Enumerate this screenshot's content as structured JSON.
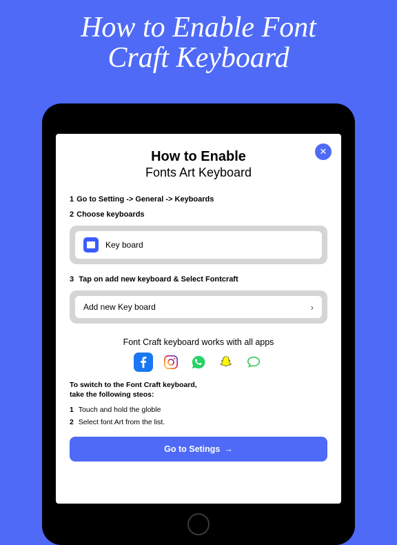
{
  "hero": {
    "line1": "How to Enable Font",
    "line2": "Craft Keyboard"
  },
  "modal": {
    "title1": "How to Enable",
    "title2": "Fonts Art Keyboard",
    "close_glyph": "✕",
    "steps": {
      "s1": "Go to Setting -> General -> Keyboards",
      "s2": "Choose keyboards",
      "s3": "Tap on add new keyboard & Select Fontcraft"
    },
    "row1_label": "Key board",
    "row2_label": "Add new Key board",
    "chevron": "›",
    "works_with": "Font Craft keyboard works with all apps",
    "switch_hdr_l1": "To switch to the Font Craft keyboard,",
    "switch_hdr_l2": "take the following steos:",
    "switch_s1": "Touch and hold the globle",
    "switch_s2": "Select font Art from the list.",
    "cta": "Go to Setings",
    "arrow": "→"
  },
  "app_icons": [
    "facebook-icon",
    "instagram-icon",
    "whatsapp-icon",
    "snapchat-icon",
    "messages-icon"
  ]
}
